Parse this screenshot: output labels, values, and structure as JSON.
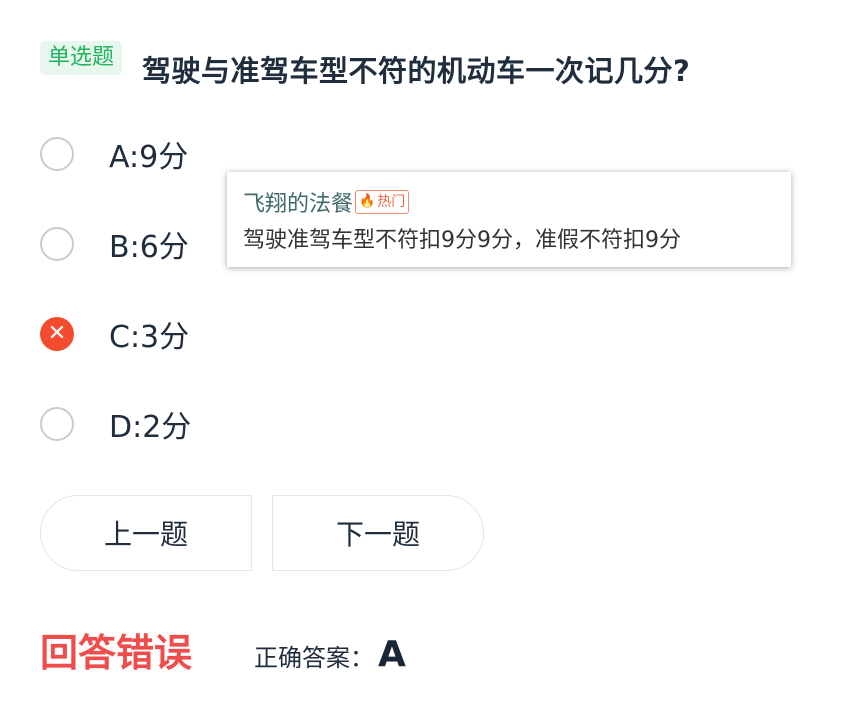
{
  "question": {
    "type_tag": "单选题",
    "title": "驾驶与准驾车型不符的机动车一次记几分?"
  },
  "options": [
    {
      "label": "A:9分",
      "state": "unselected"
    },
    {
      "label": "B:6分",
      "state": "unselected"
    },
    {
      "label": "C:3分",
      "state": "wrong"
    },
    {
      "label": "D:2分",
      "state": "unselected"
    }
  ],
  "popup": {
    "user": "飞翔的法餐",
    "badge": "热门",
    "text": "驾驶准驾车型不符扣9分9分，准假不符扣9分"
  },
  "buttons": {
    "prev": "上一题",
    "next": "下一题"
  },
  "result": {
    "status": "回答错误",
    "answer_label": "正确答案：",
    "answer_value": "A"
  },
  "colors": {
    "tag_bg": "#e7f7ee",
    "tag_text": "#22b35e",
    "wrong": "#f24b2e",
    "status_red": "#ef4c4c"
  }
}
